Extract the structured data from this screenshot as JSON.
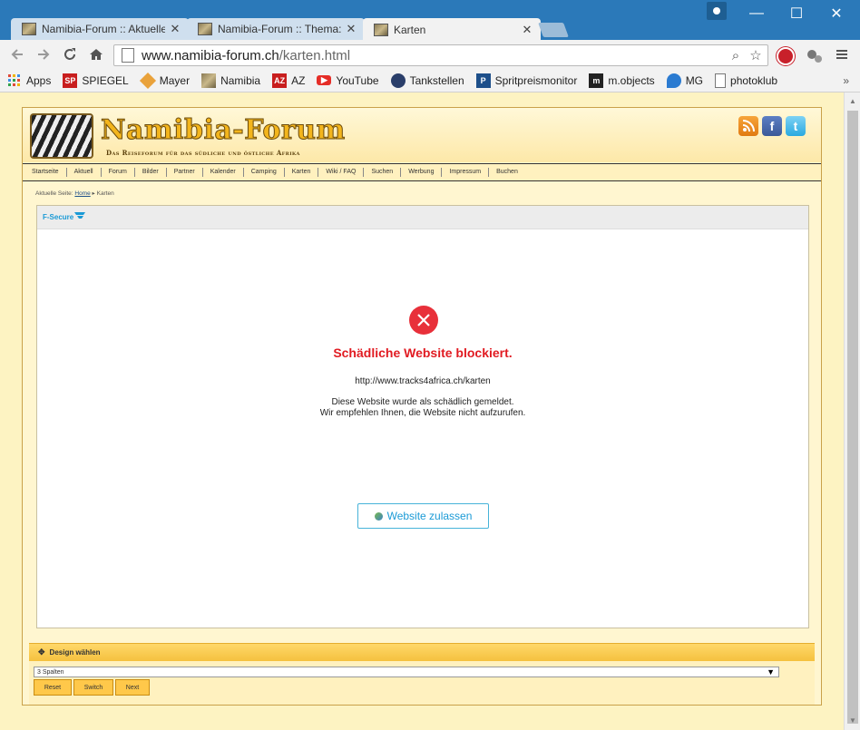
{
  "browser": {
    "tabs": [
      {
        "title": "Namibia-Forum :: Aktuelle",
        "active": false
      },
      {
        "title": "Namibia-Forum :: Thema: I",
        "active": false
      },
      {
        "title": "Karten",
        "active": true
      }
    ],
    "tab_close_glyph": "✕",
    "window_controls": {
      "minimize": "—",
      "maximize": "☐",
      "close": "✕"
    },
    "address": {
      "domain": "www.namibia-forum.ch",
      "path": "/karten.html"
    },
    "bookmarks": [
      {
        "label": "Apps",
        "icon": "apps-grid-icon",
        "color": "#e04a3a"
      },
      {
        "label": "SPIEGEL",
        "icon": "spiegel-icon",
        "color": "#c81e1e"
      },
      {
        "label": "Mayer",
        "icon": "mayer-icon",
        "color": "#e9a23b"
      },
      {
        "label": "Namibia",
        "icon": "namibia-icon",
        "color": "#8a7b55"
      },
      {
        "label": "AZ",
        "icon": "az-icon",
        "color": "#c81e1e"
      },
      {
        "label": "YouTube",
        "icon": "youtube-icon",
        "color": "#e52d27"
      },
      {
        "label": "Tankstellen",
        "icon": "tankstellen-icon",
        "color": "#2a3e6a"
      },
      {
        "label": "Spritpreismonitor",
        "icon": "spritpreismonitor-icon",
        "color": "#1d4f8a"
      },
      {
        "label": "m.objects",
        "icon": "mobjects-icon",
        "color": "#222222"
      },
      {
        "label": "MG",
        "icon": "mg-icon",
        "color": "#2b7bd1"
      },
      {
        "label": "photoklub",
        "icon": "page-icon",
        "color": "#ffffff"
      }
    ],
    "bookmarks_more": "»"
  },
  "site": {
    "title": "Namibia-Forum",
    "subtitle": "Das Reiseforum für das südliche und östliche Afrika",
    "nav": [
      "Startseite",
      "Aktuell",
      "Forum",
      "Bilder",
      "Partner",
      "Kalender",
      "Camping",
      "Karten",
      "Wiki / FAQ",
      "Suchen",
      "Werbung",
      "Impressum",
      "Buchen"
    ],
    "breadcrumb": {
      "prefix": "Aktuelle Seite:",
      "home": "Home",
      "separator": "▸",
      "current": "Karten"
    },
    "social": {
      "rss": "rss-icon",
      "facebook": "f",
      "twitter": "t"
    }
  },
  "block_page": {
    "brand": "F-Secure",
    "title": "Schädliche Website blockiert.",
    "url": "http://www.tracks4africa.ch/karten",
    "message_line1": "Diese Website wurde als schädlich gemeldet.",
    "message_line2": "Wir empfehlen Ihnen, die Website nicht aufzurufen.",
    "allow_button": "Website zulassen",
    "accent": "#e11b22",
    "brand_color": "#1a9ad6"
  },
  "design": {
    "header": "Design wählen",
    "select_value": "3 Spalten",
    "buttons": [
      "Reset",
      "Switch",
      "Next"
    ]
  }
}
